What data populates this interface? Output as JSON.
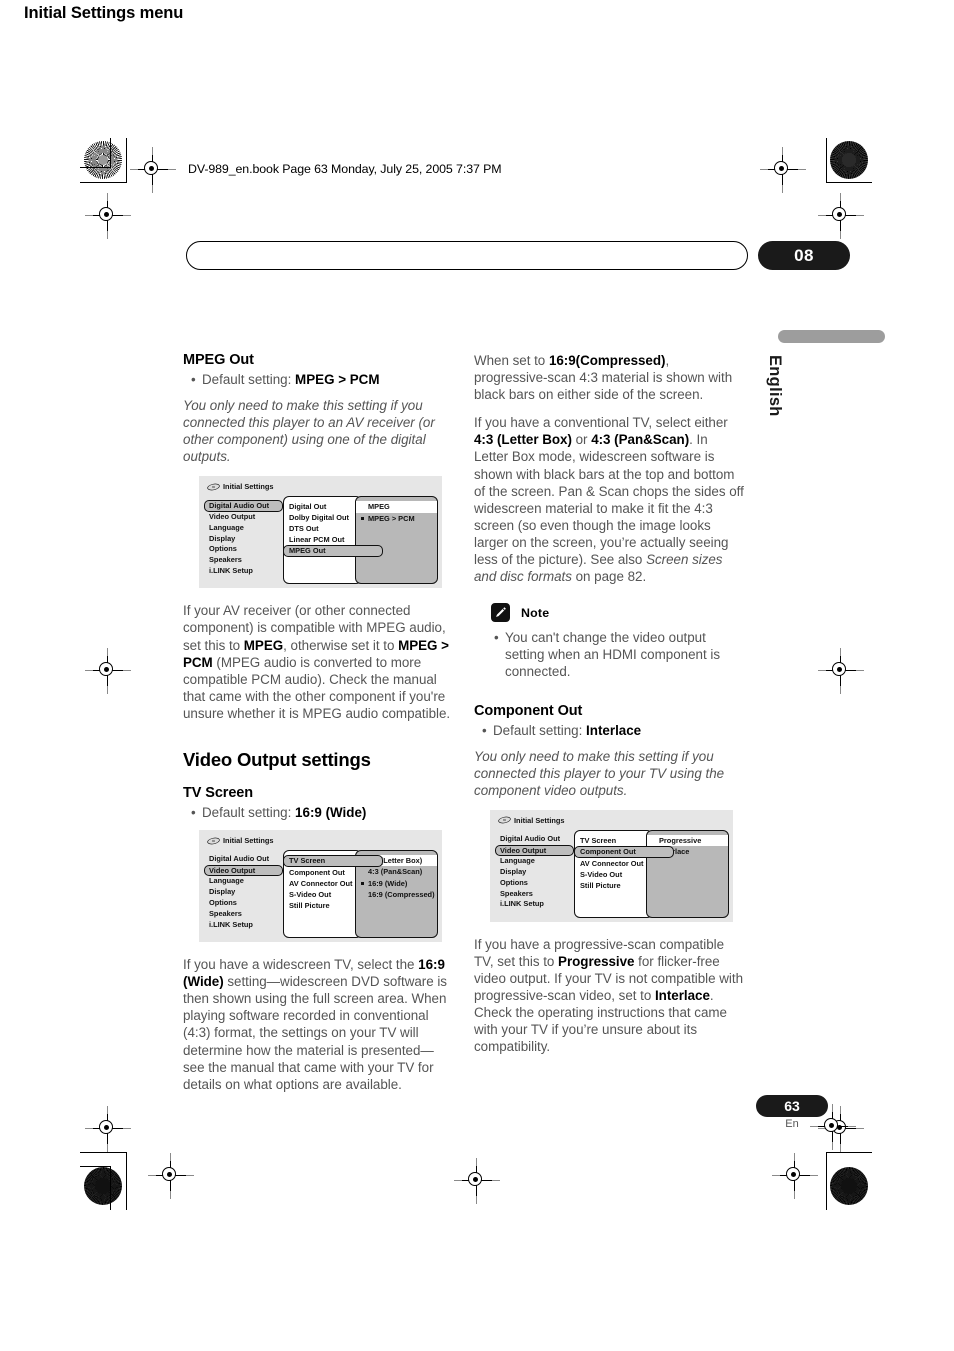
{
  "header": {
    "book_line": "DV-989_en.book  Page 63  Monday, July 25, 2005  7:37 PM",
    "chapter_title": "Initial Settings menu",
    "chapter_number": "08",
    "side_language": "English"
  },
  "footer": {
    "page_number": "63",
    "page_language": "En"
  },
  "left_column": {
    "mpeg_out": {
      "heading": "MPEG Out",
      "default_setting_label": "Default setting: ",
      "default_setting_value": "MPEG > PCM",
      "intro": "You only need to make this setting if you connected this player to an AV receiver (or other component) using one of the digital outputs.",
      "body_part1": "If your AV receiver (or other connected component) is compatible with MPEG audio, set this to ",
      "body_bold1": "MPEG",
      "body_part2": ", otherwise set it to ",
      "body_bold2": "MPEG > PCM",
      "body_part3": " (MPEG audio is converted to more compatible PCM audio). Check the manual that came with the other component if you're unsure whether it is MPEG audio compatible."
    },
    "video_output_heading": "Video Output settings",
    "tv_screen": {
      "heading": "TV Screen",
      "default_setting_label": "Default setting: ",
      "default_setting_value": "16:9 (Wide)",
      "body_part1": "If you have a widescreen TV, select the ",
      "body_bold1": "16:9 (Wide)",
      "body_part2": " setting—widescreen DVD software is then shown using the full screen area. When playing software recorded in conventional (4:3) format, the settings on your TV will determine how the material is presented—see the manual that came with your TV for details on what options are available."
    }
  },
  "right_column": {
    "compressed_para_part1": "When set to ",
    "compressed_para_bold1": "16:9(Compressed)",
    "compressed_para_part2": ", progressive-scan 4:3 material is shown with black bars on either side of the screen.",
    "conventional_part1": "If you have a conventional TV, select either ",
    "conventional_bold1": "4:3 (Letter Box)",
    "conventional_part2": " or ",
    "conventional_bold2": "4:3 (Pan&Scan)",
    "conventional_part3": ". In Letter Box mode, widescreen software is shown with black bars at the top and bottom of the screen. Pan & Scan chops the sides off widescreen material to make it fit the 4:3 screen (so even though the image looks larger on the screen, you’re actually seeing less of the picture). See also ",
    "conventional_italic": "Screen sizes and disc formats",
    "conventional_part4": " on page 82.",
    "note": {
      "label": "Note",
      "items": [
        "You can't change the video output setting when an HDMI component is connected."
      ]
    },
    "component_out": {
      "heading": "Component Out",
      "default_setting_label": "Default setting: ",
      "default_setting_value": "Interlace",
      "intro": "You only need to make this setting if you connected this player to your TV using the component video outputs.",
      "body_part1": "If you have a progressive-scan compatible TV, set this to ",
      "body_bold1": "Progressive",
      "body_part2": " for flicker-free video output. If your TV is not compatible with progressive-scan video, set to ",
      "body_bold2": "Interlace",
      "body_part3": ". Check the operating instructions that came with your TV if you’re unsure about its compatibility."
    }
  },
  "osd_figures": {
    "mpeg_out": {
      "title": "Initial Settings",
      "categories": [
        {
          "label": "Digital Audio Out",
          "selected": true
        },
        {
          "label": "Video Output",
          "selected": false
        },
        {
          "label": "Language",
          "selected": false
        },
        {
          "label": "Display",
          "selected": false
        },
        {
          "label": "Options",
          "selected": false
        },
        {
          "label": "Speakers",
          "selected": false
        },
        {
          "label": "i.LINK Setup",
          "selected": false
        }
      ],
      "subitems": [
        {
          "label": "Digital Out",
          "selected": false
        },
        {
          "label": "Dolby Digital Out",
          "selected": false
        },
        {
          "label": "DTS Out",
          "selected": false
        },
        {
          "label": "Linear PCM Out",
          "selected": false
        },
        {
          "label": "MPEG Out",
          "selected": true
        }
      ],
      "options": [
        {
          "label": "MPEG",
          "highlighted": true,
          "marked": false
        },
        {
          "label": "MPEG > PCM",
          "highlighted": false,
          "marked": true
        }
      ]
    },
    "tv_screen": {
      "title": "Initial Settings",
      "categories": [
        {
          "label": "Digital Audio Out",
          "selected": false
        },
        {
          "label": "Video Output",
          "selected": true
        },
        {
          "label": "Language",
          "selected": false
        },
        {
          "label": "Display",
          "selected": false
        },
        {
          "label": "Options",
          "selected": false
        },
        {
          "label": "Speakers",
          "selected": false
        },
        {
          "label": "i.LINK Setup",
          "selected": false
        }
      ],
      "subitems": [
        {
          "label": "TV Screen",
          "selected": true
        },
        {
          "label": "Component Out",
          "selected": false
        },
        {
          "label": "AV Connector Out",
          "selected": false
        },
        {
          "label": "S-Video Out",
          "selected": false
        },
        {
          "label": "Still Picture",
          "selected": false
        }
      ],
      "options": [
        {
          "label": "4:3 (Letter Box)",
          "highlighted": true,
          "marked": false
        },
        {
          "label": "4:3 (Pan&Scan)",
          "highlighted": false,
          "marked": false
        },
        {
          "label": "16:9 (Wide)",
          "highlighted": false,
          "marked": true
        },
        {
          "label": "16:9 (Compressed)",
          "highlighted": false,
          "marked": false
        }
      ]
    },
    "component_out": {
      "title": "Initial Settings",
      "categories": [
        {
          "label": "Digital Audio Out",
          "selected": false
        },
        {
          "label": "Video Output",
          "selected": true
        },
        {
          "label": "Language",
          "selected": false
        },
        {
          "label": "Display",
          "selected": false
        },
        {
          "label": "Options",
          "selected": false
        },
        {
          "label": "Speakers",
          "selected": false
        },
        {
          "label": "i.LINK Setup",
          "selected": false
        }
      ],
      "subitems": [
        {
          "label": "TV Screen",
          "selected": false
        },
        {
          "label": "Component Out",
          "selected": true
        },
        {
          "label": "AV Connector Out",
          "selected": false
        },
        {
          "label": "S-Video Out",
          "selected": false
        },
        {
          "label": "Still Picture",
          "selected": false
        }
      ],
      "options": [
        {
          "label": "Progressive",
          "highlighted": true,
          "marked": false
        },
        {
          "label": "Interlace",
          "highlighted": false,
          "marked": true
        }
      ]
    }
  }
}
